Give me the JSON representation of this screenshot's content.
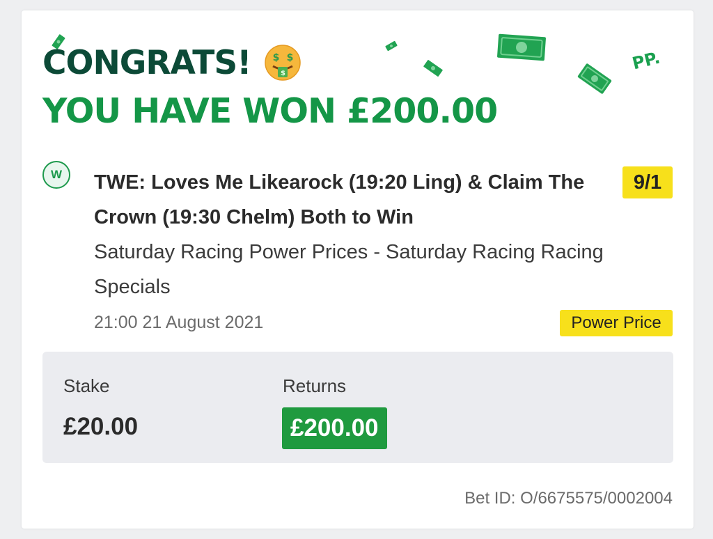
{
  "header": {
    "title": "CONGRATS!",
    "subtitle": "YOU HAVE WON £200.00",
    "logo_text": "PP.",
    "emoji": "money-mouth-face-icon"
  },
  "bet": {
    "result_badge": "W",
    "selection": "TWE: Loves Me Likearock (19:20 Ling) & Claim The Crown (19:30 Chelm) Both to Win",
    "odds": "9/1",
    "market": "Saturday Racing Power Prices - Saturday Racing Racing Specials",
    "datetime": "21:00 21 August 2021",
    "tag": "Power Price"
  },
  "summary": {
    "stake_label": "Stake",
    "stake_value": "£20.00",
    "returns_label": "Returns",
    "returns_value": "£200.00"
  },
  "footer": {
    "bet_id": "Bet ID: O/6675575/0002004"
  },
  "colors": {
    "title_dark_green": "#0c4a37",
    "title_green": "#149647",
    "highlight_yellow": "#f7e01b",
    "returns_green": "#1f9a3f"
  }
}
